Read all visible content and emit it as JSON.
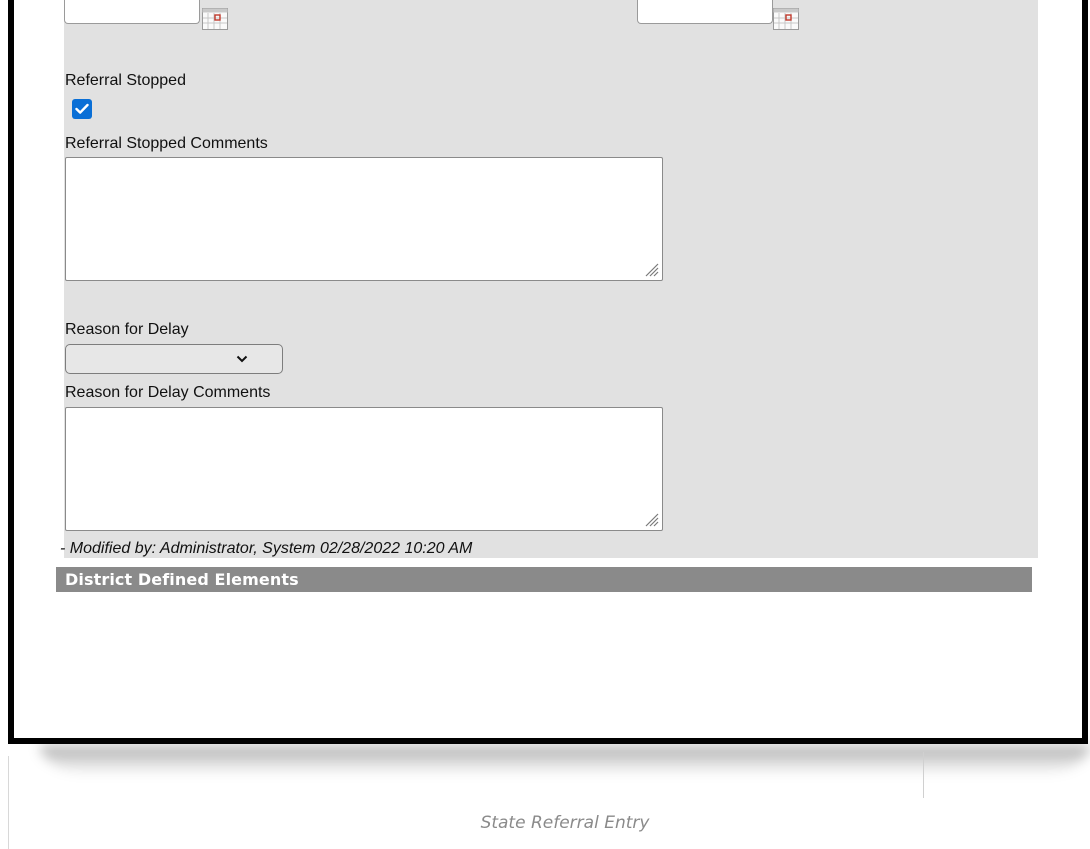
{
  "form": {
    "referral_stopped_label": "Referral Stopped",
    "referral_stopped_checked": true,
    "referral_stopped_comments_label": "Referral Stopped Comments",
    "referral_stopped_comments_value": "",
    "reason_for_delay_label": "Reason for Delay",
    "reason_for_delay_selected": "",
    "reason_for_delay_comments_label": "Reason for Delay Comments",
    "reason_for_delay_comments_value": "",
    "modified_text": "- Modified by: Administrator, System 02/28/2022 10:20 AM"
  },
  "sections": {
    "district_defined_elements": "District Defined Elements"
  },
  "caption": "State Referral Entry",
  "colors": {
    "panel_bg": "#e1e1e1",
    "section_bar_bg": "#8a8a8a",
    "checkbox_accent": "#0a6fd6"
  },
  "icons": {
    "calendar": "calendar-icon",
    "checkmark": "checkmark-icon",
    "dropdown": "chevron-down-icon",
    "resize": "resize-grip-icon"
  }
}
